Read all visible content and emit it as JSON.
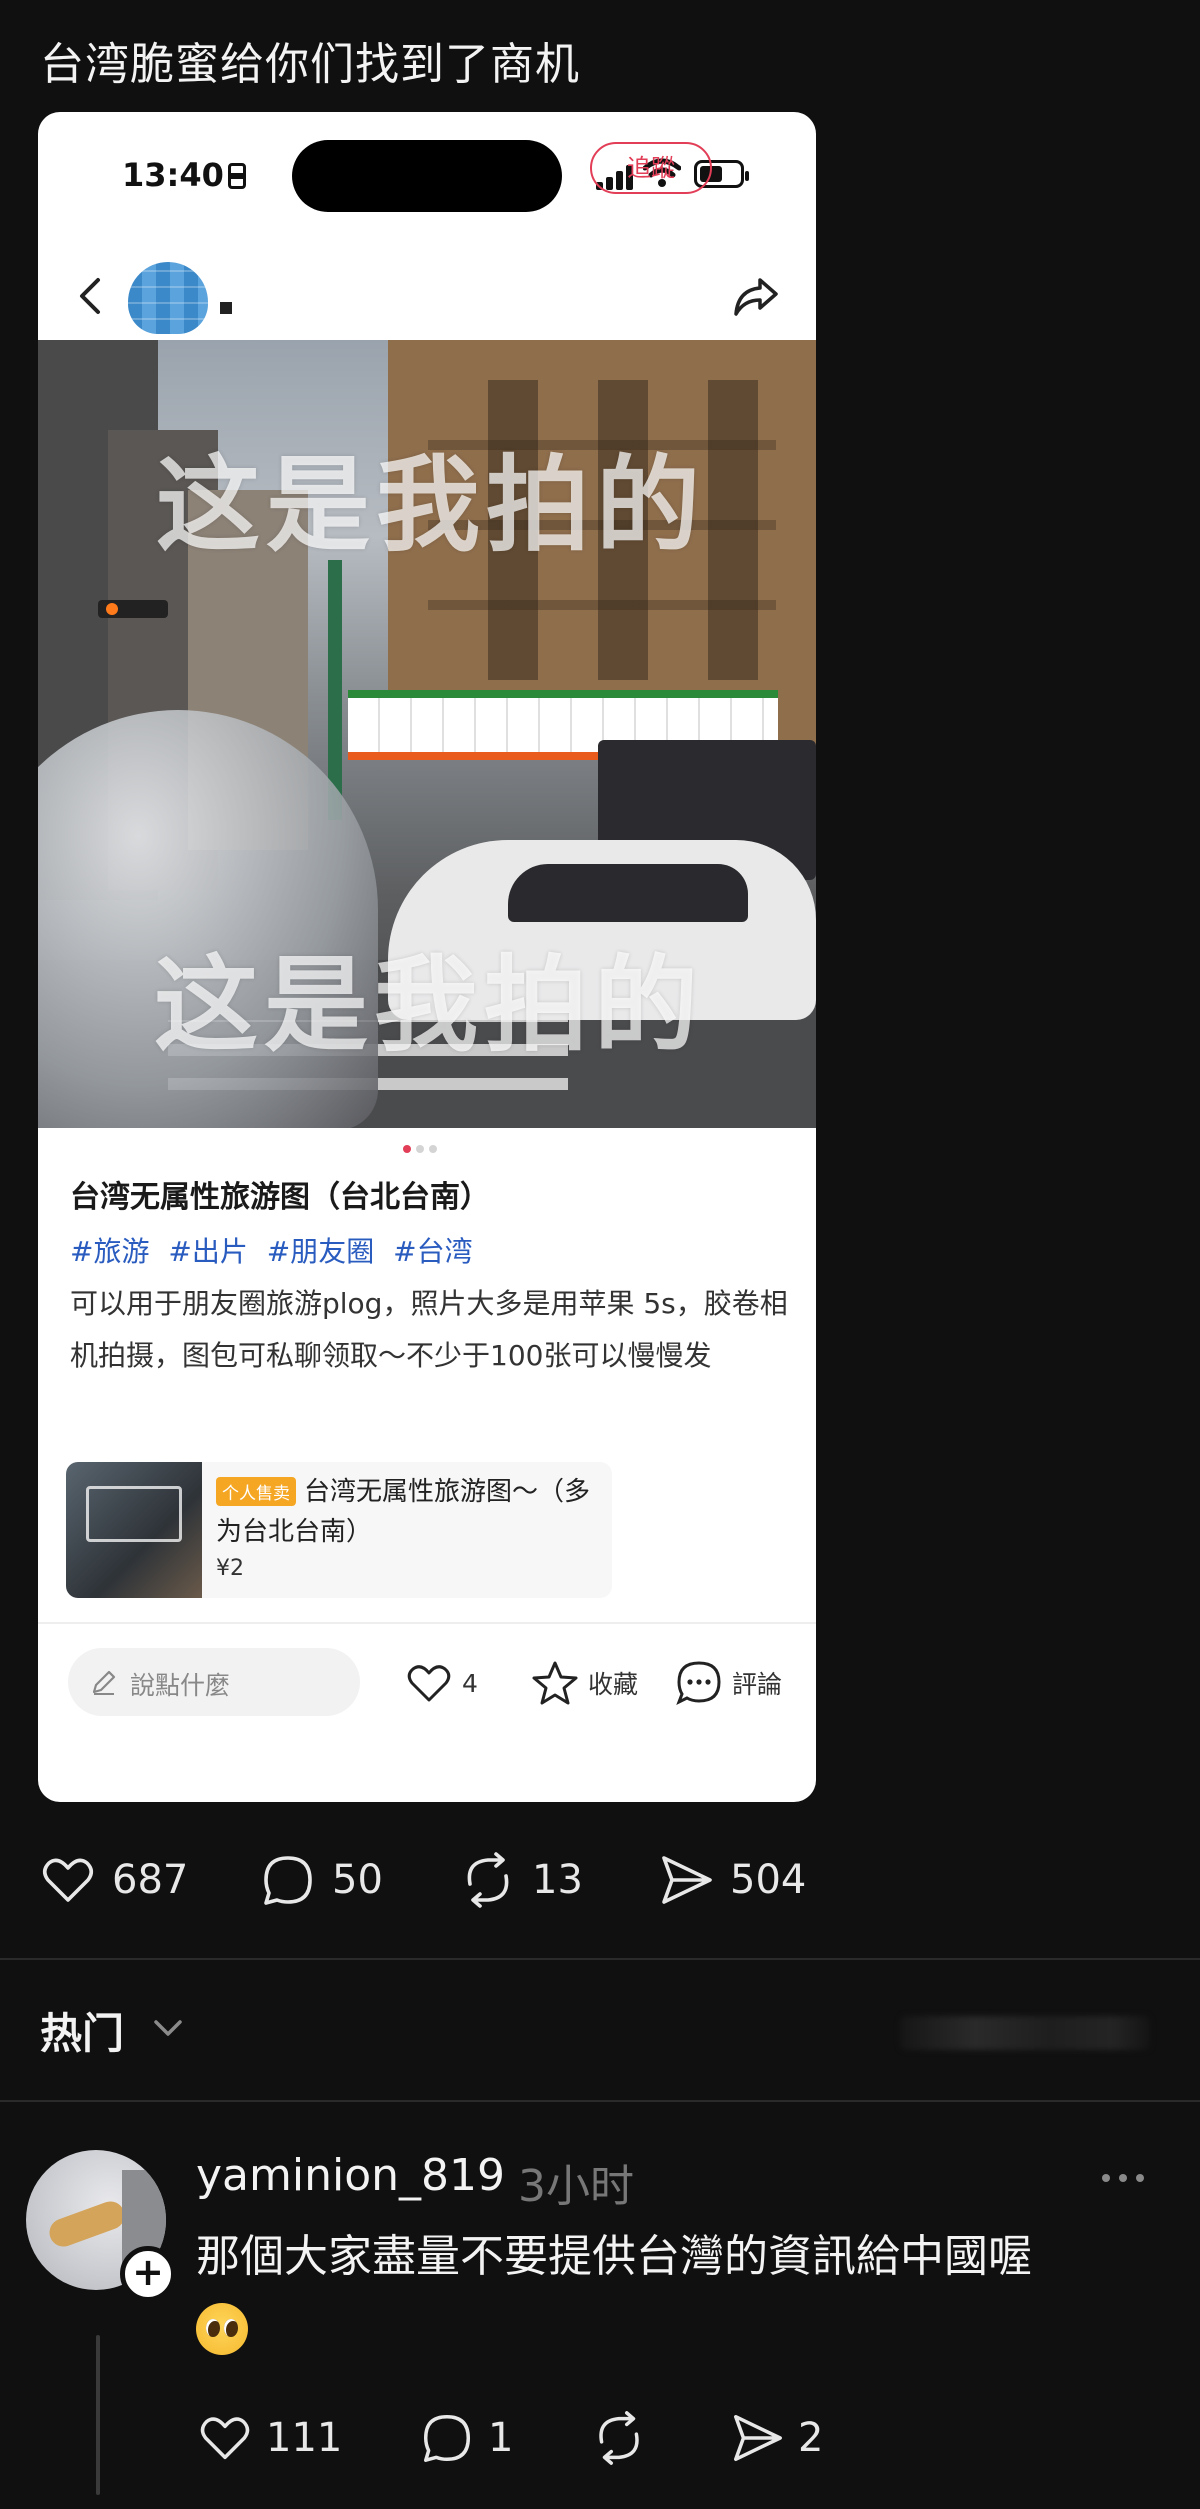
{
  "post": {
    "text": "台湾脆蜜给你们找到了商机"
  },
  "embedded": {
    "status_time": "13:40",
    "follow_label": "追蹤",
    "watermark_top": "这是我拍的",
    "watermark_bottom": "这是我拍的",
    "title": "台湾无属性旅游图（台北台南）",
    "hashtags": [
      "#旅游",
      "#出片",
      "#朋友圈",
      "#台湾"
    ],
    "description": "可以用于朋友圈旅游plog，照片大多是用苹果 5s，胶卷相机拍摄，图包可私聊领取～不少于100张可以慢慢发",
    "product": {
      "tag": "个人售卖",
      "name": "台湾无属性旅游图～（多为台北台南）",
      "price": "¥2"
    },
    "comment_placeholder": "說點什麼",
    "like_count": "4",
    "favorite_label": "收藏",
    "comment_label": "評論"
  },
  "post_actions": {
    "likes": "687",
    "replies": "50",
    "reposts": "13",
    "shares": "504"
  },
  "sort": {
    "label": "热门"
  },
  "reply": {
    "username": "yaminion_819",
    "time": "3小时",
    "text": "那個大家盡量不要提供台灣的資訊給中國喔",
    "emoji": "pleading-face",
    "likes": "111",
    "replies": "1",
    "shares": "2"
  },
  "colors": {
    "background": "#101010",
    "accent_red": "#e23e57",
    "hashtag_blue": "#2a5cc0",
    "tag_orange": "#f5a623"
  }
}
